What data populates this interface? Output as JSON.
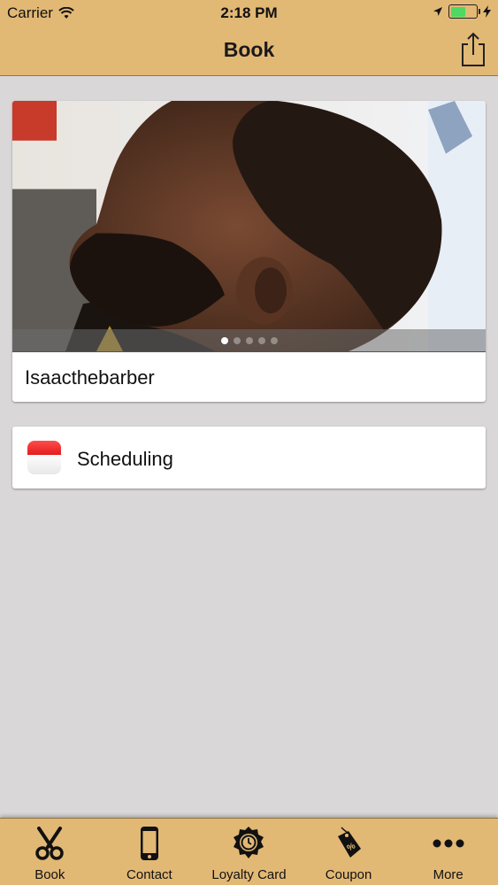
{
  "status_bar": {
    "carrier": "Carrier",
    "time": "2:18 PM",
    "battery_color": "#4cd964"
  },
  "nav": {
    "title": "Book",
    "share_icon": "share-icon",
    "background": "#e2b875"
  },
  "gallery": {
    "caption": "Isaacthebarber",
    "page_count": 5,
    "active_page": 1
  },
  "scheduling": {
    "label": "Scheduling",
    "icon": "calendar-icon"
  },
  "tabbar": {
    "items": [
      {
        "label": "Book",
        "icon": "scissors-icon"
      },
      {
        "label": "Contact",
        "icon": "phone-icon"
      },
      {
        "label": "Loyalty Card",
        "icon": "loyalty-badge-icon"
      },
      {
        "label": "Coupon",
        "icon": "coupon-tag-icon"
      },
      {
        "label": "More",
        "icon": "more-dots-icon"
      }
    ]
  }
}
